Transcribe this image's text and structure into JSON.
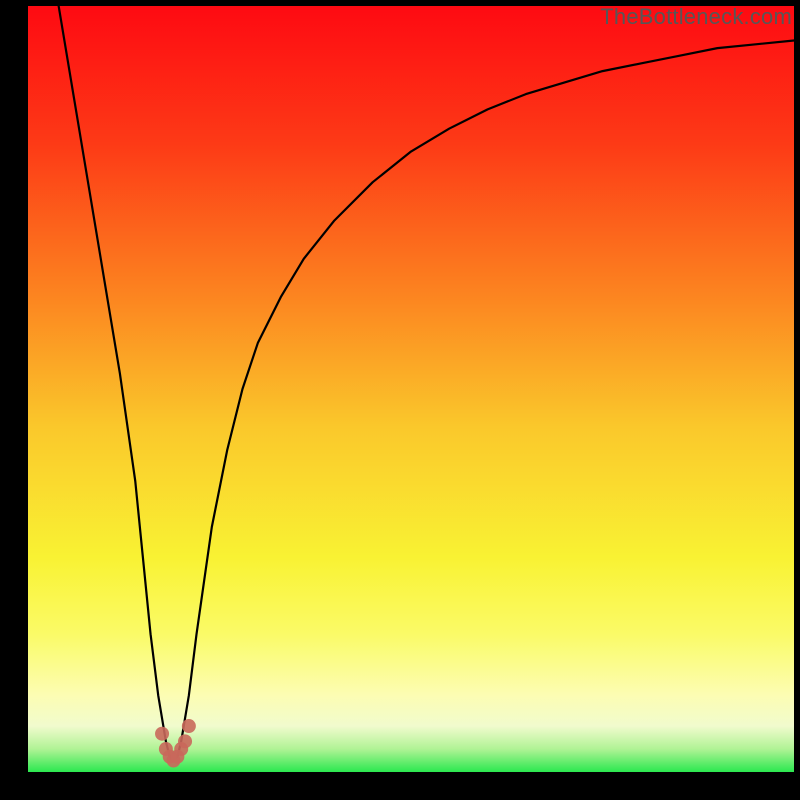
{
  "watermark": "TheBottleneck.com",
  "chart_data": {
    "type": "line",
    "title": "",
    "xlabel": "",
    "ylabel": "",
    "xlim": [
      0,
      100
    ],
    "ylim": [
      0,
      100
    ],
    "grid": false,
    "series": [
      {
        "name": "main-curve",
        "x": [
          4,
          6,
          8,
          10,
          12,
          14,
          15,
          16,
          17,
          18,
          18.5,
          19,
          19.5,
          20,
          21,
          22,
          24,
          26,
          28,
          30,
          33,
          36,
          40,
          45,
          50,
          55,
          60,
          65,
          70,
          75,
          80,
          85,
          90,
          95,
          100
        ],
        "y": [
          100,
          88,
          76,
          64,
          52,
          38,
          28,
          18,
          10,
          4,
          2,
          1.5,
          2,
          4,
          10,
          18,
          32,
          42,
          50,
          56,
          62,
          67,
          72,
          77,
          81,
          84,
          86.5,
          88.5,
          90,
          91.5,
          92.5,
          93.5,
          94.5,
          95,
          95.5
        ]
      }
    ],
    "dip_region": {
      "x": [
        17.5,
        18.0,
        18.5,
        19.0,
        19.5,
        20.0,
        20.5,
        21.0
      ],
      "y": [
        5.0,
        3.0,
        2.0,
        1.5,
        2.0,
        3.0,
        4.0,
        6.0
      ]
    },
    "gradient_stops": [
      {
        "pct": 0,
        "color": "#fe0a12"
      },
      {
        "pct": 18,
        "color": "#fd3a16"
      },
      {
        "pct": 38,
        "color": "#fc8520"
      },
      {
        "pct": 55,
        "color": "#fac82b"
      },
      {
        "pct": 72,
        "color": "#f9f233"
      },
      {
        "pct": 82,
        "color": "#fafb67"
      },
      {
        "pct": 90,
        "color": "#fcfdb3"
      },
      {
        "pct": 94,
        "color": "#f1fbcd"
      },
      {
        "pct": 97,
        "color": "#b0f395"
      },
      {
        "pct": 100,
        "color": "#2be84f"
      }
    ]
  }
}
